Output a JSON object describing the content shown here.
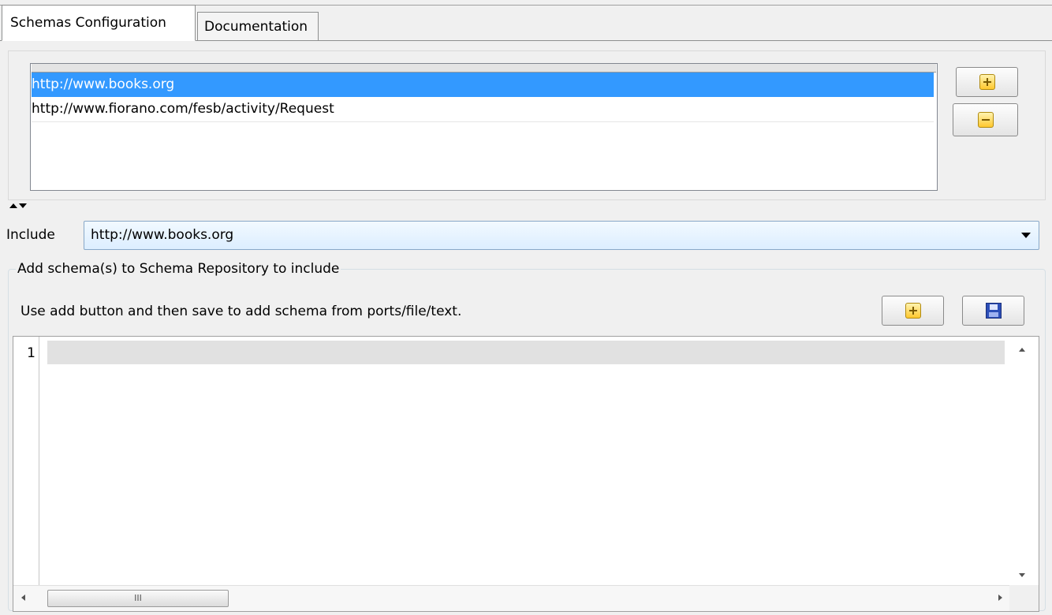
{
  "tabs": [
    {
      "label": "Schemas Configuration",
      "active": true
    },
    {
      "label": "Documentation",
      "active": false
    }
  ],
  "schema_list": {
    "items": [
      {
        "url": "http://www.books.org",
        "selected": true
      },
      {
        "url": "http://www.fiorano.com/fesb/activity/Request",
        "selected": false
      }
    ],
    "add_icon": "plus-icon",
    "remove_icon": "minus-icon"
  },
  "include": {
    "label": "Include",
    "selected_value": "http://www.books.org"
  },
  "repository": {
    "title": "Add schema(s) to Schema Repository to include",
    "hint": "Use add button and then save to add schema from ports/file/text.",
    "add_icon": "plus-icon",
    "save_icon": "floppy-disk-icon"
  },
  "editor": {
    "line_numbers": [
      "1"
    ],
    "content": "",
    "h_thumb_grip": "III"
  },
  "colors": {
    "selection": "#3399ff",
    "current_line": "#e1e1e1",
    "panel": "#f0f0f0"
  }
}
